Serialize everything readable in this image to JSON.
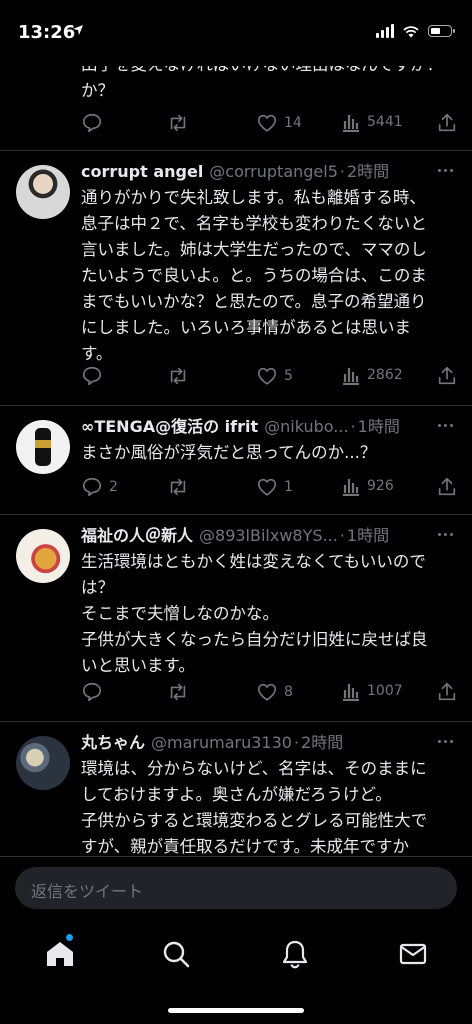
{
  "status": {
    "time": "13:26"
  },
  "tweets": [
    {
      "text": "田子を変えなければいけない理由はなんですか？",
      "textShown": "か？",
      "replies": "",
      "likes": "14",
      "views": "5441"
    },
    {
      "name": "corrupt angel",
      "handle": "@corruptangel5",
      "time": "2時間",
      "text": "通りがかりで失礼致します。私も離婚する時、\n息子は中２で、名字も学校も変わりたくないと\n言いました。姉は大学生だったので、ママのし\nたいようで良いよ。と。うちの場合は、このま\nまでもいいかな？と思たので。息子の希望通り\nにしました。いろいろ事情があるとは思いま\nす。",
      "replies": "",
      "likes": "5",
      "views": "2862"
    },
    {
      "name": "∞TENGA@復活の ifrit",
      "handle": "@nikubo...",
      "time": "1時間",
      "text": "まさか風俗が浮気だと思ってんのか...？",
      "replies": "2",
      "likes": "1",
      "views": "926"
    },
    {
      "name": "福祉の人＠新人",
      "handle": "@893lBilxw8YS...",
      "time": "1時間",
      "text": "生活環境はともかく姓は変えなくてもいいので\nは？\nそこまで夫憎しなのかな。\n子供が大きくなったら自分だけ旧姓に戻せば良\nいと思います。",
      "replies": "",
      "likes": "8",
      "views": "1007"
    },
    {
      "name": "丸ちゃん",
      "handle": "@marumaru3130",
      "time": "2時間",
      "text": "環境は、分からないけど、名字は、そのままに\nしておけますよ。奥さんが嫌だろうけど。\n子供からすると環境変わるとグレる可能性大で\nすが、親が責任取るだけです。未成年ですか"
    }
  ],
  "compose": {
    "placeholder": "返信をツイート"
  },
  "tabs": [
    "home",
    "search",
    "notifications",
    "messages"
  ],
  "colors": {
    "accent": "#1d9bf0",
    "background": "#000000",
    "muted": "#71767b"
  }
}
